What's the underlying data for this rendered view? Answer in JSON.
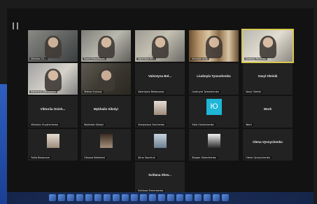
{
  "tiles": [
    {
      "name": "Vitalina Ch..."
    },
    {
      "name": "Daria Krasnikova"
    },
    {
      "name": "Valentina Bl..."
    },
    {
      "name": "Victoria Lenz"
    },
    {
      "name": "Aleksey Hlukhov"
    },
    {
      "name": "Kateryna Zakharova"
    },
    {
      "name": "Yelena Krylova"
    },
    {
      "name": "Valentyna Bel...",
      "sub": "Valentyna Bielousova"
    },
    {
      "name": "Liudmyla Tymoshenko",
      "sub": "Liudmyla Tymoshenko"
    },
    {
      "name": "Vasyl Oleinik",
      "sub": "Vasyl Oleinik"
    },
    {
      "name": "Viktoriia Onish...",
      "sub": "Viktoriia Onyshchenko"
    },
    {
      "name": "Mykhailo Sikolyi",
      "sub": "Mykhailo Sikolyi"
    },
    {
      "name": "Vladyslava Yurchenko"
    },
    {
      "name": "Yulia Onishchenko",
      "initials": "Ю"
    },
    {
      "name": "Work",
      "sub": "Work"
    },
    {
      "name": "Yuliia Baranova"
    },
    {
      "name": "Oksana Bakhmet"
    },
    {
      "name": "Alina Savchuk"
    },
    {
      "name": "Stepan Shevchenko"
    },
    {
      "name": "Olena Vynnychenko",
      "sub": "Olena Vynnychenko"
    },
    {
      "name": "Svitlana Shev...",
      "sub": "Svitlana Shevchenko"
    }
  ],
  "colors": {
    "active_border": "#d7c94e",
    "avatar_blue": "#1eb7d6"
  }
}
